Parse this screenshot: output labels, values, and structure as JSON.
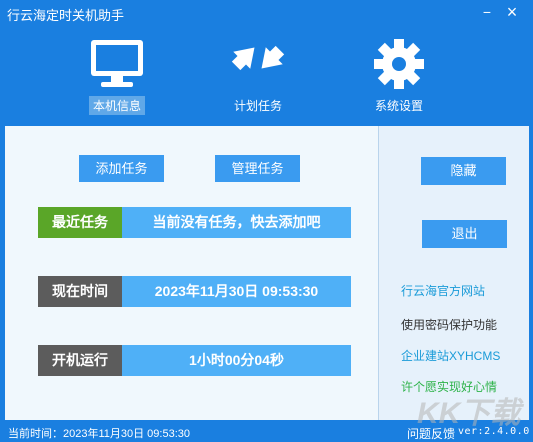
{
  "window": {
    "title": "行云海定时关机助手",
    "minimize_glyph": "−",
    "close_glyph": "×"
  },
  "nav": {
    "items": [
      {
        "label": "本机信息",
        "icon": "monitor-icon",
        "active": true
      },
      {
        "label": "计划任务",
        "icon": "arrows-icon",
        "active": false
      },
      {
        "label": "系统设置",
        "icon": "gear-icon",
        "active": false
      }
    ]
  },
  "main": {
    "add_task_button": "添加任务",
    "manage_task_button": "管理任务",
    "rows": [
      {
        "label": "最近任务",
        "value": "当前没有任务，快去添加吧",
        "label_color": "#5aa628"
      },
      {
        "label": "现在时间",
        "value": "2023年11月30日  09:53:30",
        "label_color": "#5c5c5c"
      },
      {
        "label": "开机运行",
        "value": "1小时00分04秒",
        "label_color": "#5c5c5c"
      }
    ]
  },
  "side": {
    "hide_button": "隐藏",
    "exit_button": "退出",
    "links": [
      {
        "text": "行云海官方网站",
        "color": "#1a9bd8"
      },
      {
        "text": "使用密码保护功能",
        "color": "#333333"
      },
      {
        "text": "企业建站XYHCMS",
        "color": "#1a9bd8"
      },
      {
        "text": "许个愿实现好心情",
        "color": "#2eb34a"
      }
    ]
  },
  "status": {
    "time_text": "当前时间：2023年11月30日  09:53:30",
    "feedback": "问题反馈",
    "version": "ver:2.4.0.0"
  },
  "watermark": "KK下载",
  "colors": {
    "accent": "#1a7fe0",
    "button": "#3a9bf0",
    "value_bar": "#4fb0f7"
  }
}
